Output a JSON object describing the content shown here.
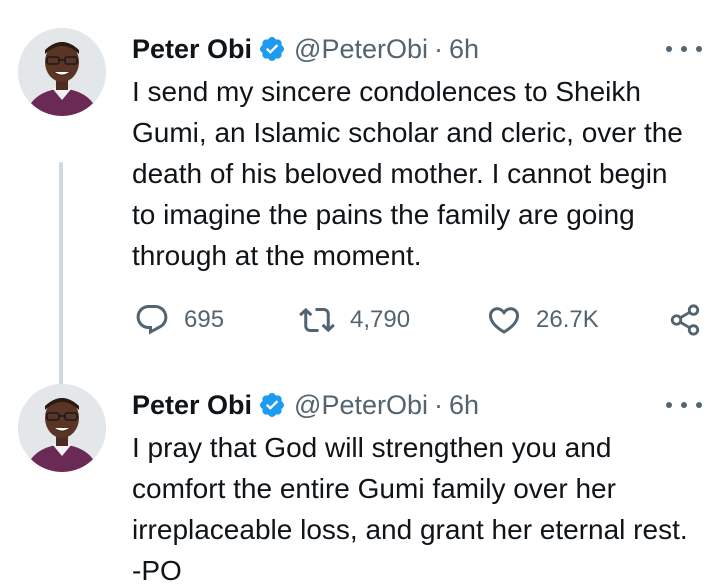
{
  "colors": {
    "verified_blue": "#1d9bf0",
    "muted_text": "#536471",
    "thread_line": "#cfd9de",
    "primary_text": "#0f1419"
  },
  "tweets": [
    {
      "author": {
        "name": "Peter Obi",
        "handle": "@PeterObi",
        "time": "6h",
        "separator": "·",
        "verified_icon": "verified-badge-icon"
      },
      "text": "I send my sincere condolences to Sheikh Gumi, an Islamic scholar and cleric, over the death of his beloved mother. I cannot begin to imagine the pains the family are going through at the moment.",
      "stats": {
        "replies": "695",
        "retweets": "4,790",
        "likes": "26.7K"
      }
    },
    {
      "author": {
        "name": "Peter Obi",
        "handle": "@PeterObi",
        "time": "6h",
        "separator": "·",
        "verified_icon": "verified-badge-icon"
      },
      "text": "I pray that God will strengthen you and comfort the entire Gumi family over her irreplaceable loss, and grant her eternal rest. -PO"
    }
  ],
  "icons": {
    "reply": "reply-icon",
    "retweet": "retweet-icon",
    "like": "heart-icon",
    "share": "share-icon",
    "more": "more-options-icon"
  }
}
